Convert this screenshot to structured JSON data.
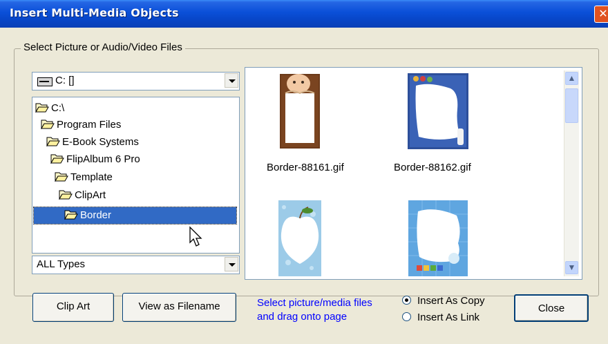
{
  "window": {
    "title": "Insert Multi-Media Objects",
    "close_glyph": "✕"
  },
  "group": {
    "legend": "Select Picture or Audio/Video Files"
  },
  "drive_combo": {
    "value": "C: []"
  },
  "tree": {
    "items": [
      {
        "label": "C:\\"
      },
      {
        "label": "Program Files"
      },
      {
        "label": "E-Book Systems"
      },
      {
        "label": "FlipAlbum 6 Pro"
      },
      {
        "label": "Template"
      },
      {
        "label": "ClipArt"
      },
      {
        "label": "Border",
        "selected": true
      }
    ]
  },
  "type_combo": {
    "value": "ALL Types"
  },
  "thumbnails": [
    {
      "label": "Border-88161.gif"
    },
    {
      "label": "Border-88162.gif"
    },
    {
      "label": ""
    },
    {
      "label": ""
    }
  ],
  "buttons": {
    "clip_art": "Clip Art",
    "view_as_filename": "View as Filename",
    "close": "Close"
  },
  "hint": {
    "line1": "Select picture/media files",
    "line2": "and drag onto page"
  },
  "insert_mode": {
    "copy_label": "Insert As Copy",
    "link_label": "Insert As Link",
    "selected": "copy"
  },
  "colors": {
    "title_bar": "#0a4fd8",
    "selection": "#316ac5",
    "hint_text": "#0000ff"
  }
}
